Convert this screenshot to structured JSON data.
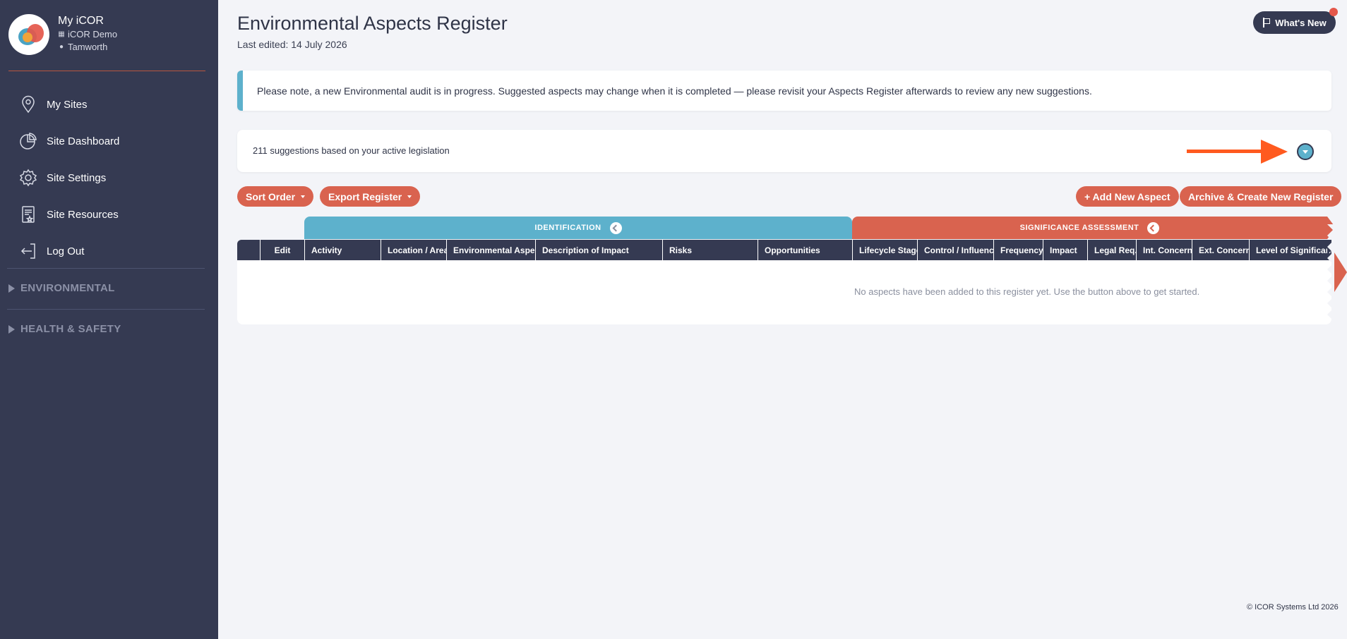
{
  "profile": {
    "name": "My iCOR",
    "org": "iCOR Demo",
    "location": "Tamworth"
  },
  "nav": {
    "items": [
      {
        "label": "My Sites",
        "icon": "location-pin-icon"
      },
      {
        "label": "Site Dashboard",
        "icon": "pie-chart-icon"
      },
      {
        "label": "Site Settings",
        "icon": "gear-icon"
      },
      {
        "label": "Site Resources",
        "icon": "document-star-icon"
      },
      {
        "label": "Log Out",
        "icon": "logout-icon"
      }
    ],
    "sections": [
      "ENVIRONMENTAL",
      "HEALTH & SAFETY"
    ]
  },
  "page": {
    "title": "Environmental Aspects Register",
    "subtitle": "Last edited: 14 July 2026",
    "whats_new": "What's New"
  },
  "notice": "Please note, a new Environmental audit is in progress. Suggested aspects may change when it is completed — please revisit your Aspects Register afterwards to review any new suggestions.",
  "suggestions": {
    "text": "211 suggestions based on your active legislation"
  },
  "toolbar": {
    "sort_order": "Sort Order",
    "export_register": "Export Register",
    "add_new_aspect": "+ Add New Aspect",
    "archive_create": "Archive & Create New Register"
  },
  "table": {
    "groups": {
      "identification": "IDENTIFICATION",
      "significance": "SIGNIFICANCE ASSESSMENT"
    },
    "columns": [
      "",
      "Edit",
      "Activity",
      "Location / Area",
      "Environmental Aspect",
      "Description of Impact",
      "Risks",
      "Opportunities",
      "Lifecycle Stage",
      "Control / Influence",
      "Frequency",
      "Impact",
      "Legal Req.",
      "Int. Concern",
      "Ext. Concern",
      "Level of Significance"
    ],
    "empty_message": "No aspects have been added to this register yet. Use the button above to get started."
  },
  "colors": {
    "sidebar": "#353a52",
    "accent_blue": "#5db1cc",
    "accent_red": "#d9634f",
    "annotation_arrow": "#ff5a1f"
  },
  "footer": "© ICOR Systems Ltd 2026"
}
